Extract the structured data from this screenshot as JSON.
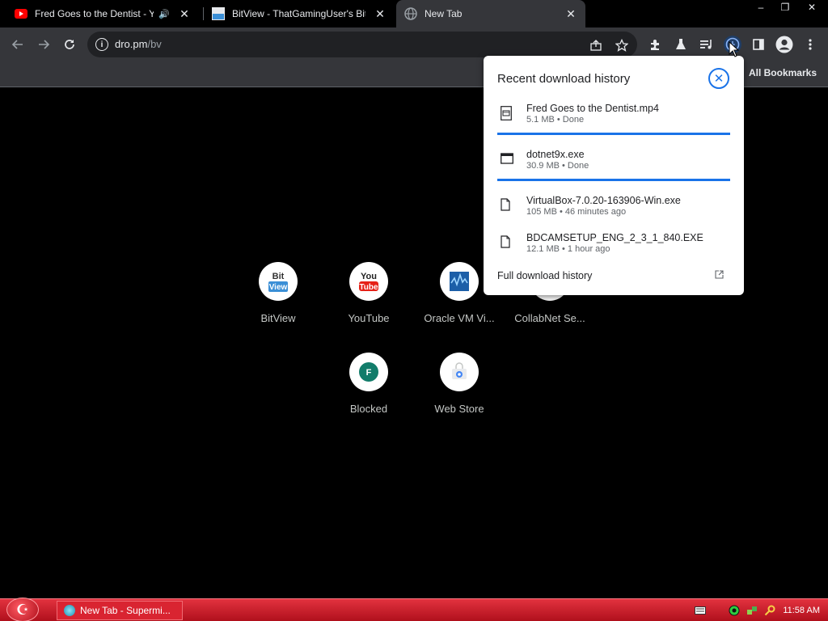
{
  "tabs": [
    {
      "title": "Fred Goes to the Dentist - Yo",
      "has_audio": true,
      "active": false
    },
    {
      "title": "BitView - ThatGamingUser's BitV",
      "has_audio": false,
      "active": false
    },
    {
      "title": "New Tab",
      "has_audio": false,
      "active": true
    }
  ],
  "window_controls": {
    "minimize": "–",
    "restore": "❐",
    "close": "✕"
  },
  "toolbar": {
    "url_host": "dro.pm",
    "url_path": "/bv"
  },
  "bookmarks_bar": {
    "all_bookmarks_label": "All Bookmarks"
  },
  "shortcuts": [
    {
      "label": "BitView"
    },
    {
      "label": "YouTube"
    },
    {
      "label": "Oracle VM Vi..."
    },
    {
      "label": "CollabNet Se..."
    },
    {
      "label": "Blocked"
    },
    {
      "label": "Web Store"
    }
  ],
  "shortcut_icons": {
    "bitview_top": "Bit",
    "bitview_bottom": "View",
    "youtube_top": "You",
    "youtube_bottom": "Tube",
    "blocked_letter": "F"
  },
  "download_bubble": {
    "title": "Recent download history",
    "items": [
      {
        "name": "Fred Goes to the Dentist.mp4",
        "meta": "5.1 MB • Done",
        "icon": "video-file-icon",
        "progress_bar": true
      },
      {
        "name": "dotnet9x.exe",
        "meta": "30.9 MB • Done",
        "icon": "exe-window-icon",
        "progress_bar": true
      },
      {
        "name": "VirtualBox-7.0.20-163906-Win.exe",
        "meta": "105 MB • 46 minutes ago",
        "icon": "file-icon",
        "progress_bar": false
      },
      {
        "name": "BDCAMSETUP_ENG_2_3_1_840.EXE",
        "meta": "12.1 MB • 1 hour ago",
        "icon": "file-icon",
        "progress_bar": false
      }
    ],
    "full_history_label": "Full download history"
  },
  "taskbar": {
    "task_label": "New Tab - Supermi...",
    "clock": "11:58 AM"
  },
  "colors": {
    "accent": "#1a73e8",
    "toolbar_bg": "#35363a",
    "taskbar_red": "#d92431"
  }
}
